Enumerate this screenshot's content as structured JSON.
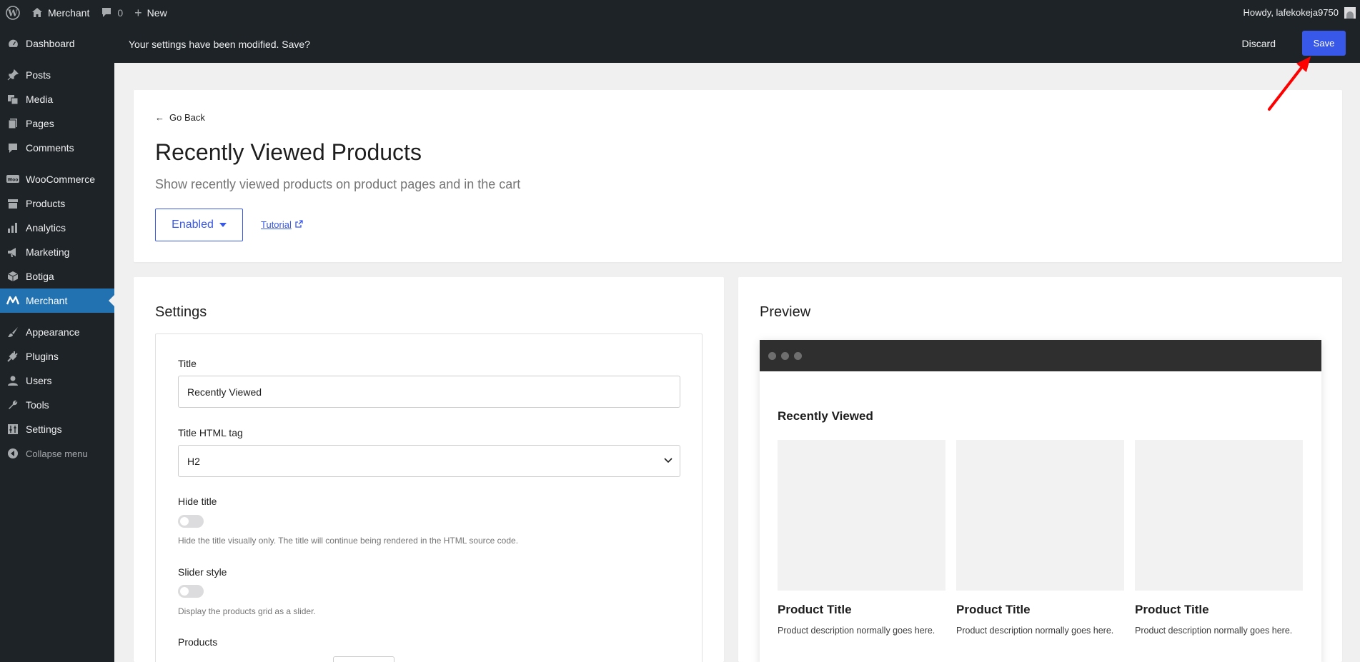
{
  "adminbar": {
    "site_name": "Merchant",
    "comments_count": "0",
    "new_label": "New",
    "howdy": "Howdy, lafekokeja9750"
  },
  "sidebar": {
    "items": [
      {
        "label": "Dashboard",
        "icon": "dashboard-icon"
      },
      {
        "label": "Posts",
        "icon": "pin-icon"
      },
      {
        "label": "Media",
        "icon": "media-icon"
      },
      {
        "label": "Pages",
        "icon": "pages-icon"
      },
      {
        "label": "Comments",
        "icon": "comment-icon"
      },
      {
        "label": "WooCommerce",
        "icon": "woo-icon"
      },
      {
        "label": "Products",
        "icon": "archive-icon"
      },
      {
        "label": "Analytics",
        "icon": "bar-chart-icon"
      },
      {
        "label": "Marketing",
        "icon": "megaphone-icon"
      },
      {
        "label": "Botiga",
        "icon": "cube-icon"
      },
      {
        "label": "Merchant",
        "icon": "merchant-icon"
      },
      {
        "label": "Appearance",
        "icon": "brush-icon"
      },
      {
        "label": "Plugins",
        "icon": "plug-icon"
      },
      {
        "label": "Users",
        "icon": "user-icon"
      },
      {
        "label": "Tools",
        "icon": "wrench-icon"
      },
      {
        "label": "Settings",
        "icon": "sliders-icon"
      },
      {
        "label": "Collapse menu",
        "icon": "collapse-icon"
      }
    ]
  },
  "notice": {
    "message": "Your settings have been modified. Save?",
    "discard_label": "Discard",
    "save_label": "Save"
  },
  "hero": {
    "go_back": "Go Back",
    "title": "Recently Viewed Products",
    "subtitle": "Show recently viewed products on product pages and in the cart",
    "status_label": "Enabled",
    "tutorial_label": "Tutorial"
  },
  "settings": {
    "heading": "Settings",
    "title_label": "Title",
    "title_value": "Recently Viewed",
    "tag_label": "Title HTML tag",
    "tag_value": "H2",
    "hide_title_label": "Hide title",
    "hide_title_help": "Hide the title visually only. The title will continue being rendered in the HTML source code.",
    "slider_label": "Slider style",
    "slider_help": "Display the products grid as a slider.",
    "products_label": "Products"
  },
  "preview": {
    "heading": "Preview",
    "section_title": "Recently Viewed",
    "products": [
      {
        "title": "Product Title",
        "desc": "Product description normally goes here."
      },
      {
        "title": "Product Title",
        "desc": "Product description normally goes here."
      },
      {
        "title": "Product Title",
        "desc": "Product description normally goes here."
      }
    ]
  },
  "colors": {
    "admin_dark": "#1d2327",
    "accent_blue": "#3858e9",
    "active_menu": "#2271b1",
    "annotation_red": "#ff0000"
  }
}
